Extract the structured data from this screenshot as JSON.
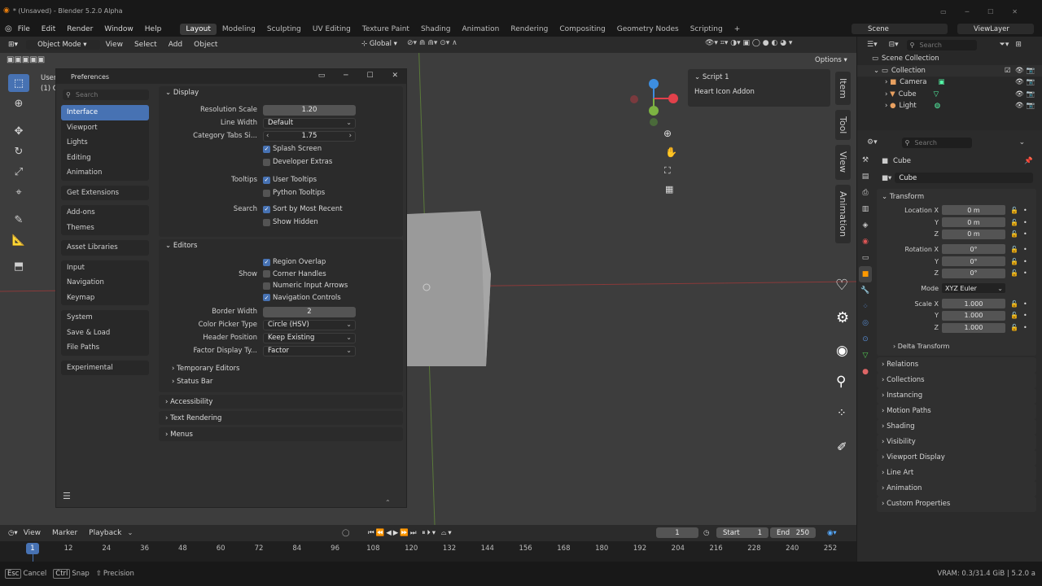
{
  "app": {
    "title": "* (Unsaved) - Blender 5.2.0 Alpha"
  },
  "menubar": {
    "menus": [
      "File",
      "Edit",
      "Render",
      "Window",
      "Help"
    ],
    "workspaces": [
      "Layout",
      "Modeling",
      "Sculpting",
      "UV Editing",
      "Texture Paint",
      "Shading",
      "Animation",
      "Rendering",
      "Compositing",
      "Geometry Nodes",
      "Scripting"
    ],
    "active_workspace": "Layout",
    "add_tab": "+",
    "scene": "Scene",
    "view_layer": "ViewLayer"
  },
  "viewport_header": {
    "mode": "Object Mode",
    "menus": [
      "View",
      "Select",
      "Add",
      "Object"
    ],
    "orientation": "Global",
    "options": "Options"
  },
  "viewport_overlay_text": {
    "line1": "User",
    "line2": "(1) C"
  },
  "preferences": {
    "title": "Preferences",
    "search_placeholder": "Search",
    "nav_groups": [
      [
        "Interface",
        "Viewport",
        "Lights",
        "Editing",
        "Animation"
      ],
      [
        "Get Extensions"
      ],
      [
        "Add-ons",
        "Themes"
      ],
      [
        "Asset Libraries"
      ],
      [
        "Input",
        "Navigation",
        "Keymap"
      ],
      [
        "System",
        "Save & Load",
        "File Paths"
      ],
      [
        "Experimental"
      ]
    ],
    "selected_nav": "Interface",
    "display": {
      "header": "Display",
      "resolution_scale_label": "Resolution Scale",
      "resolution_scale": "1.20",
      "line_width_label": "Line Width",
      "line_width": "Default",
      "category_tabs_label": "Category Tabs Si...",
      "category_tabs": "1.75",
      "splash_screen": "Splash Screen",
      "developer_extras": "Developer Extras",
      "tooltips_label": "Tooltips",
      "user_tooltips": "User Tooltips",
      "python_tooltips": "Python Tooltips",
      "search_label": "Search",
      "sort_recent": "Sort by Most Recent",
      "show_hidden": "Show Hidden"
    },
    "editors": {
      "header": "Editors",
      "region_overlap": "Region Overlap",
      "show_label": "Show",
      "corner_handles": "Corner Handles",
      "numeric_input_arrows": "Numeric Input Arrows",
      "navigation_controls": "Navigation Controls",
      "border_width_label": "Border Width",
      "border_width": "2",
      "color_picker_label": "Color Picker Type",
      "color_picker": "Circle (HSV)",
      "header_position_label": "Header Position",
      "header_position": "Keep Existing",
      "factor_display_label": "Factor Display Ty...",
      "factor_display": "Factor",
      "temporary_editors": "Temporary Editors",
      "status_bar": "Status Bar"
    },
    "collapsed_panels": [
      "Accessibility",
      "Text Rendering",
      "Menus"
    ]
  },
  "npanel": {
    "header": "Script 1",
    "content": "Heart Icon Addon"
  },
  "vertical_tabs": [
    "Item",
    "Tool",
    "View",
    "Animation"
  ],
  "outliner": {
    "search_placeholder": "Search",
    "root": "Scene Collection",
    "collection": "Collection",
    "items": [
      "Camera",
      "Cube",
      "Light"
    ]
  },
  "properties": {
    "search_placeholder": "Search",
    "object_name": "Cube",
    "object_field": "Cube",
    "transform_header": "Transform",
    "location_x_label": "Location X",
    "location_x": "0 m",
    "location_y_label": "Y",
    "location_y": "0 m",
    "location_z_label": "Z",
    "location_z": "0 m",
    "rotation_x_label": "Rotation X",
    "rotation_x": "0°",
    "rotation_y_label": "Y",
    "rotation_y": "0°",
    "rotation_z_label": "Z",
    "rotation_z": "0°",
    "mode_label": "Mode",
    "mode": "XYZ Euler",
    "scale_x_label": "Scale X",
    "scale_x": "1.000",
    "scale_y_label": "Y",
    "scale_y": "1.000",
    "scale_z_label": "Z",
    "scale_z": "1.000",
    "delta_transform": "Delta Transform",
    "sections": [
      "Relations",
      "Collections",
      "Instancing",
      "Motion Paths",
      "Shading",
      "Visibility",
      "Viewport Display",
      "Line Art",
      "Animation",
      "Custom Properties"
    ]
  },
  "timeline": {
    "menus": [
      "View",
      "Marker",
      "Playback"
    ],
    "current_frame": "1",
    "start_label": "Start",
    "start": "1",
    "end_label": "End",
    "end": "250",
    "ticks": [
      "12",
      "24",
      "36",
      "48",
      "60",
      "72",
      "84",
      "96",
      "108",
      "120",
      "132",
      "144",
      "156",
      "168",
      "180",
      "192",
      "204",
      "216",
      "228",
      "240",
      "252"
    ],
    "playhead": "1"
  },
  "status": {
    "esc_key": "Esc",
    "esc_label": "Cancel",
    "ctrl_key": "Ctrl",
    "ctrl_label": "Snap",
    "shift_label": "Precision",
    "vram": "VRAM: 0.3/31.4 GiB | 5.2.0 a"
  },
  "colors": {
    "accent": "#4772b3",
    "axis_x": "#e2414b",
    "axis_y": "#7cb342",
    "axis_z": "#3d8ee0"
  }
}
